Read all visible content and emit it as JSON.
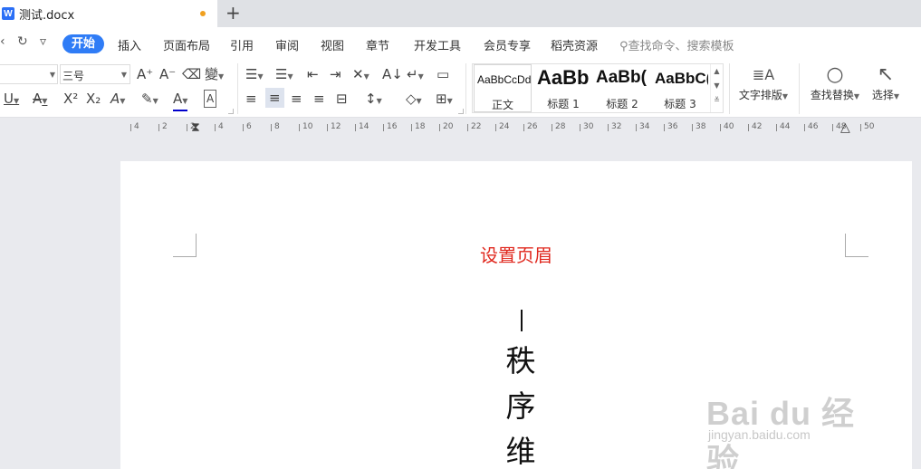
{
  "window": {
    "tab_title": "测试.docx",
    "doc_icon": "W",
    "new_tab": "+"
  },
  "menu": {
    "icons": [
      "undo-icon",
      "redo-icon",
      "quick-access-more-icon"
    ],
    "undo_glyph": "‹",
    "redo_glyph": "↻",
    "more_glyph": "▿",
    "items": [
      "开始",
      "插入",
      "页面布局",
      "引用",
      "审阅",
      "视图",
      "章节",
      "开发工具",
      "会员专享",
      "稻壳资源"
    ],
    "active": "开始",
    "search_placeholder": "查找命令、搜索模板",
    "accent": "#2f7cf6"
  },
  "ribbon": {
    "font_name": "",
    "font_size": "三号",
    "grow_font": "A⁺",
    "shrink_font": "A⁻",
    "clear_format": "⌫",
    "phonetic": "變",
    "underline": "U",
    "strikethrough": "A",
    "superscript": "X²",
    "subscript": "X₂",
    "text_effect": "A",
    "highlight": "✎",
    "font_color": "A",
    "char_border": "A",
    "bullets": "☰",
    "numbering": "☰",
    "outdent": "⇤",
    "indent": "⇥",
    "chinese_layout": "✕",
    "sort": "A↓",
    "show_marks": "↵",
    "table_tool": "▭",
    "align_left": "≡",
    "align_center": "≡",
    "align_right": "≡",
    "justify": "≡",
    "distributed": "⊟",
    "line_spacing": "↕",
    "shading": "◇",
    "borders": "⊞",
    "font_color_hex": "#0000cc",
    "styles": [
      {
        "preview": "AaBbCcDd",
        "name": "正文"
      },
      {
        "preview": "AaBb",
        "name": "标题 1"
      },
      {
        "preview": "AaBb(",
        "name": "标题 2"
      },
      {
        "preview": "AaBbC(",
        "name": "标题 3"
      }
    ],
    "text_layout": {
      "icon": "≣A",
      "label": "文字排版"
    },
    "find_replace": {
      "icon": "○",
      "label": "查找替换"
    },
    "select": {
      "icon": "↖",
      "label": "选择"
    }
  },
  "ruler": {
    "labels": [
      "4",
      "2",
      "2",
      "4",
      "6",
      "8",
      "10",
      "12",
      "14",
      "16",
      "18",
      "20",
      "22",
      "24",
      "26",
      "28",
      "30",
      "32",
      "34",
      "36",
      "38",
      "40",
      "42",
      "44",
      "46",
      "48",
      "50"
    ]
  },
  "document": {
    "header_text": "设置页眉",
    "header_color": "#e0281e",
    "vertical_chars": [
      "秩",
      "序",
      "维"
    ]
  },
  "watermark": {
    "logo": "Bai du 经验",
    "url": "jingyan.baidu.com"
  }
}
